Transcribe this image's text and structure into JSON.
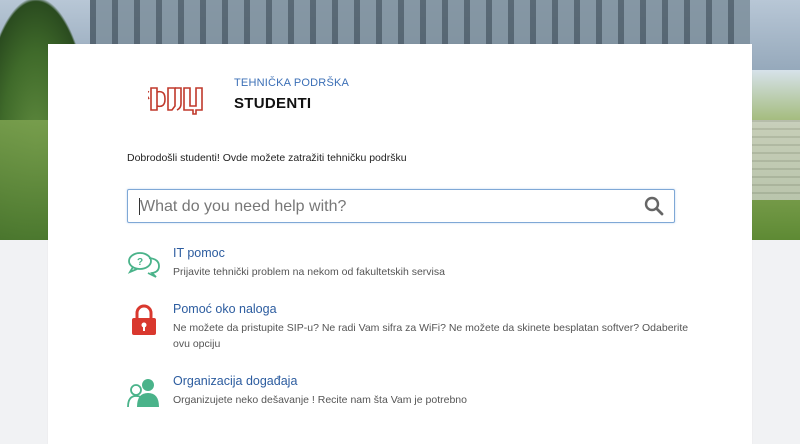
{
  "brand": {
    "subtitle": "TEHNIČKA PODRŠKA",
    "title": "STUDENTI",
    "logo_text": "ФЛЦ",
    "logo_color": "#c0392b"
  },
  "welcome_text": "Dobrodošli studenti! Ovde možete zatražiti tehničku podršku",
  "search": {
    "placeholder": "What do you need help with?",
    "value": "",
    "icon": "search-icon",
    "border_color": "#7fa8d6"
  },
  "services": [
    {
      "title": "IT pomoc",
      "description": "Prijavite tehnički problem na nekom od fakultetskih servisa",
      "icon": "chat-bubbles-icon",
      "icon_color": "#4ab38a"
    },
    {
      "title": "Pomoć oko naloga",
      "description": "Ne možete da pristupite SIP-u? Ne radi Vam sifra za WiFi? Ne možete da skinete besplatan softver? Odaberite ovu opciju",
      "icon": "lock-icon",
      "icon_color": "#d9382e"
    },
    {
      "title": "Organizacija događaja",
      "description": "Organizujete neko dešavanje ! Recite nam šta Vam je potrebno",
      "icon": "users-icon",
      "icon_color": "#4ab38a"
    }
  ],
  "colors": {
    "link": "#2c5c9f",
    "brand_blue": "#3b6fb6"
  }
}
